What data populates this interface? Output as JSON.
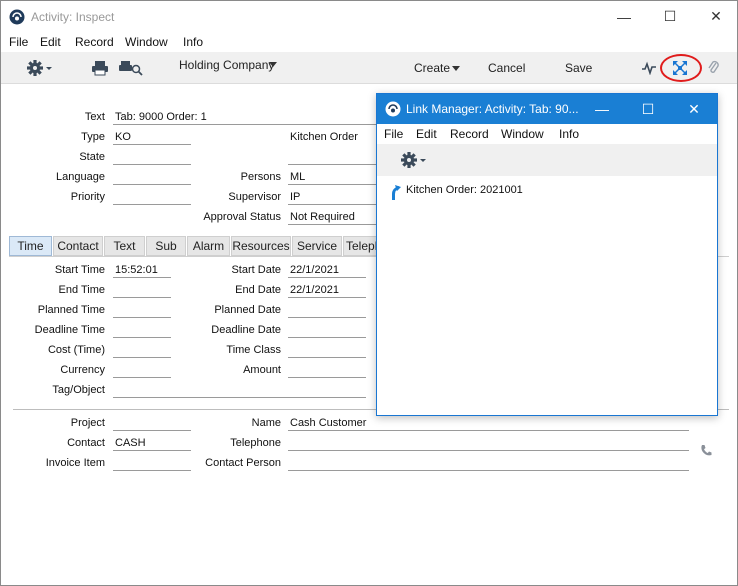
{
  "window": {
    "title": "Activity: Inspect",
    "controls": {
      "minimize": "—",
      "maximize": "☐",
      "close": "✕"
    }
  },
  "menu": [
    "File",
    "Edit",
    "Record",
    "Window",
    "Info"
  ],
  "toolbar": {
    "company": "Holding Company",
    "create": "Create",
    "cancel": "Cancel",
    "save": "Save"
  },
  "header": {
    "text_label": "Text",
    "text_value": "Tab: 9000 Order: 1",
    "type_label": "Type",
    "type_value": "KO",
    "type_desc": "Kitchen Order",
    "state_label": "State",
    "state_value": "",
    "language_label": "Language",
    "language_value": "",
    "persons_label": "Persons",
    "persons_value": "ML",
    "priority_label": "Priority",
    "priority_value": "",
    "supervisor_label": "Supervisor",
    "supervisor_value": "IP",
    "approval_label": "Approval Status",
    "approval_value": "Not Required"
  },
  "tabs": [
    "Time",
    "Contact",
    "Text",
    "Sub",
    "Alarm",
    "Resources",
    "Service",
    "Teleph"
  ],
  "time_tab": {
    "start_time_label": "Start Time",
    "start_time": "15:52:01",
    "start_date_label": "Start Date",
    "start_date": "22/1/2021",
    "end_time_label": "End Time",
    "end_time": "",
    "end_date_label": "End Date",
    "end_date": "22/1/2021",
    "planned_time_label": "Planned Time",
    "planned_time": "",
    "planned_date_label": "Planned Date",
    "planned_date": "",
    "deadline_time_label": "Deadline Time",
    "deadline_time": "",
    "deadline_date_label": "Deadline Date",
    "deadline_date": "",
    "cost_time_label": "Cost (Time)",
    "cost_time": "",
    "time_class_label": "Time Class",
    "time_class": "",
    "currency_label": "Currency",
    "currency": "",
    "amount_label": "Amount",
    "amount": "",
    "tag_label": "Tag/Object",
    "tag": ""
  },
  "footer": {
    "project_label": "Project",
    "project": "",
    "name_label": "Name",
    "name": "Cash Customer",
    "contact_label": "Contact",
    "contact": "CASH",
    "telephone_label": "Telephone",
    "telephone": "",
    "invoice_item_label": "Invoice Item",
    "invoice_item": "",
    "contact_person_label": "Contact Person",
    "contact_person": ""
  },
  "link_manager": {
    "title": "Link Manager: Activity: Tab: 90...",
    "menu": [
      "File",
      "Edit",
      "Record",
      "Window",
      "Info"
    ],
    "items": [
      "Kitchen Order: 2021001"
    ]
  },
  "colors": {
    "accent": "#1a7fd4",
    "highlight": "#e01b1b"
  }
}
